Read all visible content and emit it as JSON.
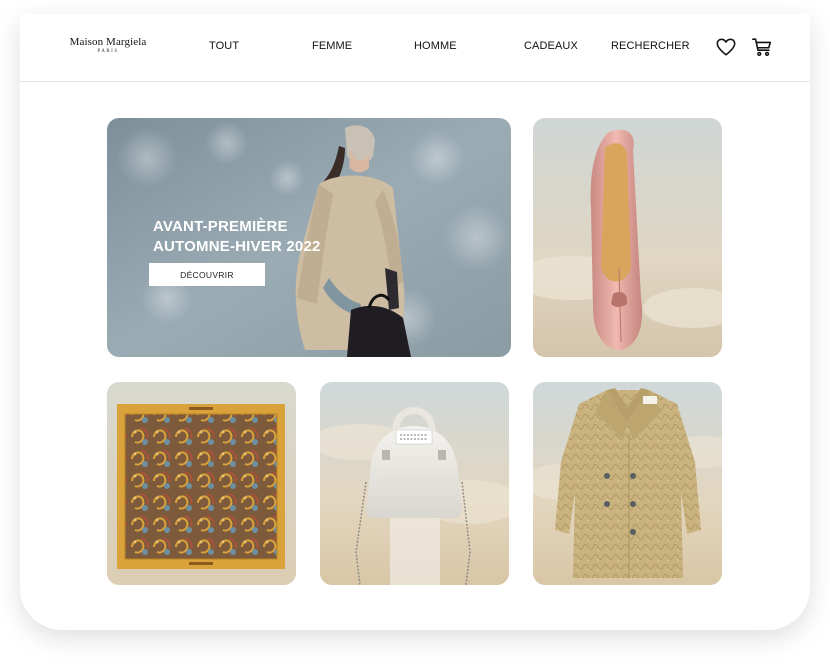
{
  "brand": {
    "name": "Maison Margiela",
    "location": "PARIS"
  },
  "nav": {
    "items": [
      {
        "label": "TOUT"
      },
      {
        "label": "FEMME"
      },
      {
        "label": "HOMME"
      },
      {
        "label": "CADEAUX"
      },
      {
        "label": "RECHERCHER"
      }
    ],
    "icons": [
      "heart-icon",
      "cart-icon"
    ]
  },
  "hero": {
    "title_line1": "AVANT-PREMIÈRE",
    "title_line2": "AUTOMNE-HIVER 2022",
    "cta_label": "DÉCOUVRIR"
  },
  "colors": {
    "text": "#111111",
    "hero_bg": "#8d9ea8",
    "sky": "#d9d2c2",
    "shoe": "#e0a39c",
    "scarf": "#d9a23a",
    "coat": "#c9b27e"
  }
}
